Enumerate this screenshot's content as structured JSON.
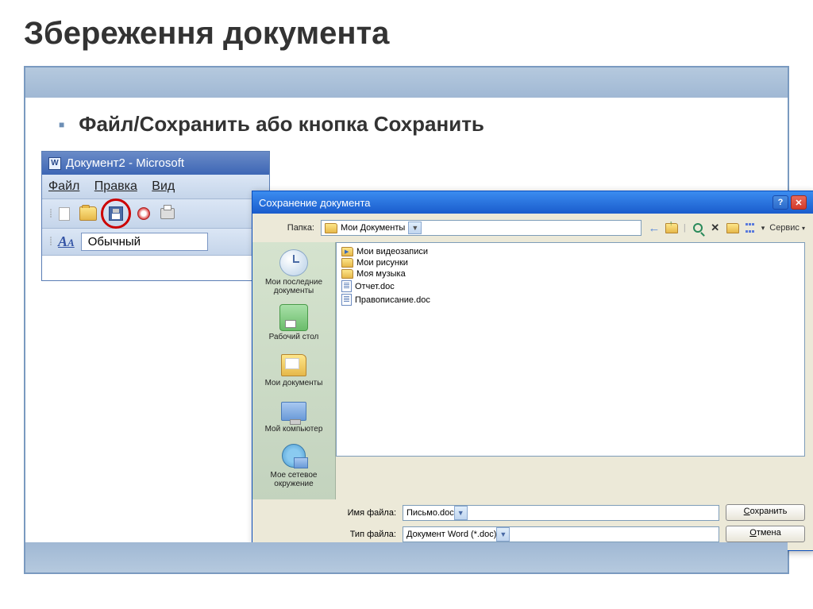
{
  "slide": {
    "title": "Збереження документа",
    "bullet": "Файл/Сохранить  або кнопка Сохранить"
  },
  "word": {
    "title": "Документ2 - Microsoft",
    "menu": {
      "file": "Файл",
      "edit": "Правка",
      "view": "Вид"
    },
    "style": "Обычный"
  },
  "dialog": {
    "title": "Сохранение документа",
    "folder_label": "Папка:",
    "current_folder": "Мои Документы",
    "tools_label": "Сервис",
    "sidebar": [
      {
        "label": "Мои последние документы"
      },
      {
        "label": "Рабочий стол"
      },
      {
        "label": "Мои документы"
      },
      {
        "label": "Мой компьютер"
      },
      {
        "label": "Мое сетевое окружение"
      }
    ],
    "files": [
      {
        "name": "Мои видеозаписи",
        "type": "folder-video"
      },
      {
        "name": "Мои рисунки",
        "type": "folder-img"
      },
      {
        "name": "Моя музыка",
        "type": "folder"
      },
      {
        "name": "Отчет.doc",
        "type": "doc"
      },
      {
        "name": "Правописание.doc",
        "type": "doc"
      }
    ],
    "filename_label": "Имя файла:",
    "filename_value": "Письмо.doc",
    "filetype_label": "Тип файла:",
    "filetype_value": "Документ Word (*.doc)",
    "save_btn": "Сохранить",
    "cancel_btn": "Отмена"
  }
}
